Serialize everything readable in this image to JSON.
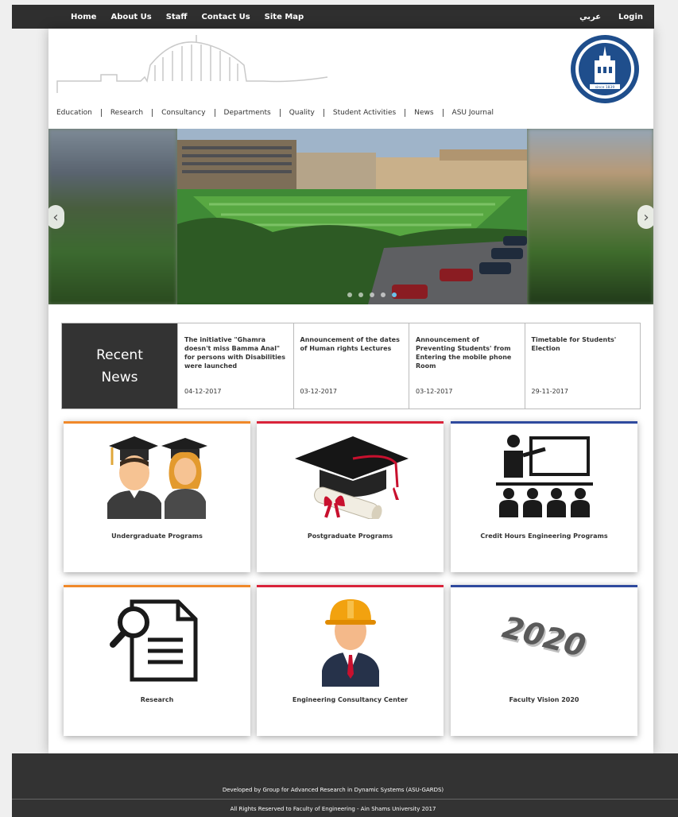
{
  "topbar": {
    "links": [
      "Home",
      "About Us",
      "Staff",
      "Contact Us",
      "Site Map"
    ],
    "arabic": "عربي",
    "login": "Login"
  },
  "mainnav": [
    "Education",
    "Research",
    "Consultancy",
    "Departments",
    "Quality",
    "Student Activities",
    "News",
    "ASU Journal"
  ],
  "logo": {
    "since_text": "since 1839"
  },
  "news": {
    "title_line1": "Recent",
    "title_line2": "News",
    "items": [
      {
        "headline": "The initiative \"Ghamra doesn't miss Bamma Anal\" for persons with Disabilities were launched",
        "date": "04-12-2017"
      },
      {
        "headline": "Announcement of the dates of Human rights Lectures",
        "date": "03-12-2017"
      },
      {
        "headline": "Announcement of Preventing Students' from Entering the mobile phone Room",
        "date": "03-12-2017"
      },
      {
        "headline": "Timetable for Students' Election",
        "date": "29-11-2017"
      }
    ]
  },
  "cards": [
    {
      "label": "Undergraduate Programs",
      "icon": "students-icon"
    },
    {
      "label": "Postgraduate Programs",
      "icon": "graduation-cap-icon"
    },
    {
      "label": "Credit Hours Engineering Programs",
      "icon": "lecture-icon"
    },
    {
      "label": "Research",
      "icon": "research-document-icon"
    },
    {
      "label": "Engineering Consultancy Center",
      "icon": "engineer-icon"
    },
    {
      "label": "Faculty Vision 2020",
      "icon": "vision-2020-icon",
      "art_text": "2020"
    }
  ],
  "footer": {
    "line1": "Developed by Group for Advanced Research in Dynamic Systems (ASU-GARDS)",
    "line2": "All Rights Reserved to Faculty of Engineering - Ain Shams University 2017"
  },
  "colors": {
    "orange": "#f0892a",
    "red": "#d9233a",
    "blue": "#2f4a9e",
    "dark": "#333333"
  }
}
